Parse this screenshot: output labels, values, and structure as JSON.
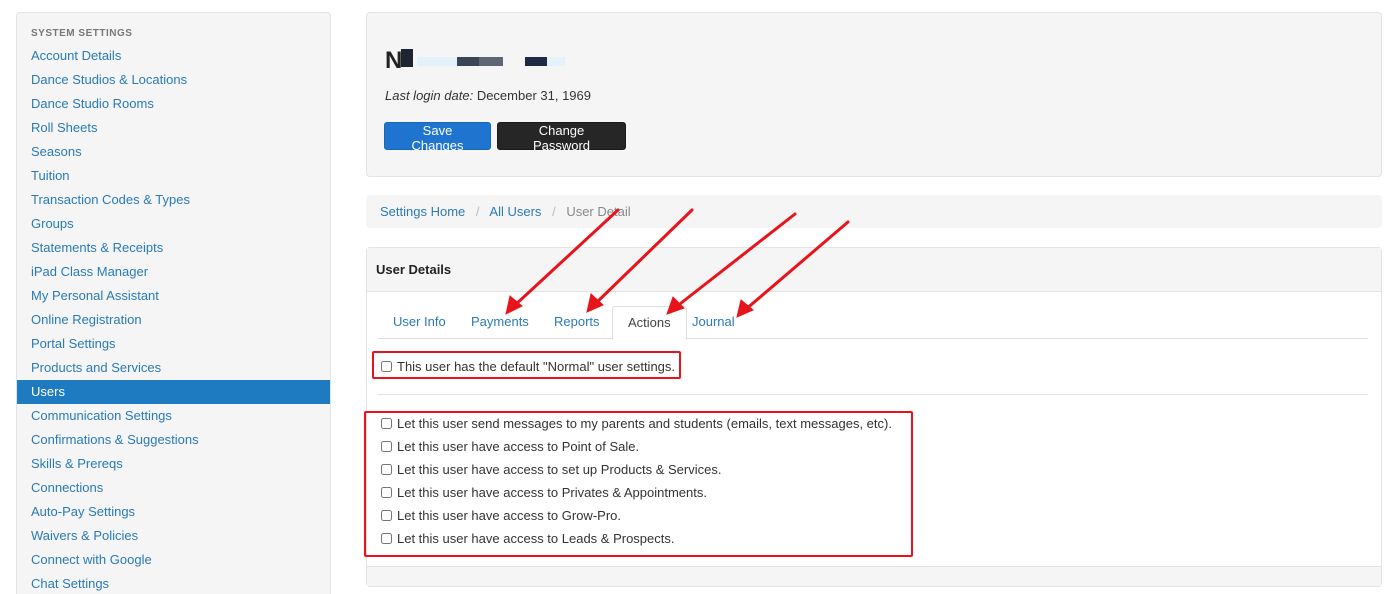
{
  "sidebar": {
    "heading": "SYSTEM SETTINGS",
    "active_index": 15,
    "items": [
      {
        "label": "Account Details"
      },
      {
        "label": "Dance Studios & Locations"
      },
      {
        "label": "Dance Studio Rooms"
      },
      {
        "label": "Roll Sheets"
      },
      {
        "label": "Seasons"
      },
      {
        "label": "Tuition"
      },
      {
        "label": "Transaction Codes & Types"
      },
      {
        "label": "Groups"
      },
      {
        "label": "Statements & Receipts"
      },
      {
        "label": "iPad Class Manager"
      },
      {
        "label": "My Personal Assistant"
      },
      {
        "label": "Online Registration"
      },
      {
        "label": "Portal Settings"
      },
      {
        "label": "Products and Services"
      },
      {
        "label": "Users"
      },
      {
        "label": "Communication Settings"
      },
      {
        "label": "Confirmations & Suggestions"
      },
      {
        "label": "Skills & Prereqs"
      },
      {
        "label": "Connections"
      },
      {
        "label": "Auto-Pay Settings"
      },
      {
        "label": "Waivers & Policies"
      },
      {
        "label": "Connect with Google"
      },
      {
        "label": "Chat Settings"
      }
    ]
  },
  "header": {
    "user_name_initial": "N",
    "last_login_label": "Last login date:",
    "last_login_value": "December 31, 1969",
    "save_label": "Save Changes",
    "change_password_label": "Change Password"
  },
  "breadcrumb": {
    "home": "Settings Home",
    "users": "All Users",
    "current": "User Detail"
  },
  "details": {
    "title": "User Details",
    "tabs": [
      {
        "label": "User Info"
      },
      {
        "label": "Payments"
      },
      {
        "label": "Reports"
      },
      {
        "label": "Actions"
      },
      {
        "label": "Journal"
      }
    ],
    "active_tab": "Actions",
    "default_setting": "This user has the default \"Normal\" user settings.",
    "permissions": [
      {
        "label": "Let this user send messages to my parents and students (emails, text messages, etc)."
      },
      {
        "label": "Let this user have access to Point of Sale."
      },
      {
        "label": "Let this user have access to set up Products & Services."
      },
      {
        "label": "Let this user have access to Privates & Appointments."
      },
      {
        "label": "Let this user have access to Grow-Pro."
      },
      {
        "label": "Let this user have access to Leads & Prospects."
      }
    ]
  },
  "colors": {
    "link": "#2a7ab8",
    "active_sidebar": "#1f7bc1",
    "primary_button": "#1e74cf",
    "dark_button": "#262626",
    "annotation_red": "#e8141b"
  }
}
